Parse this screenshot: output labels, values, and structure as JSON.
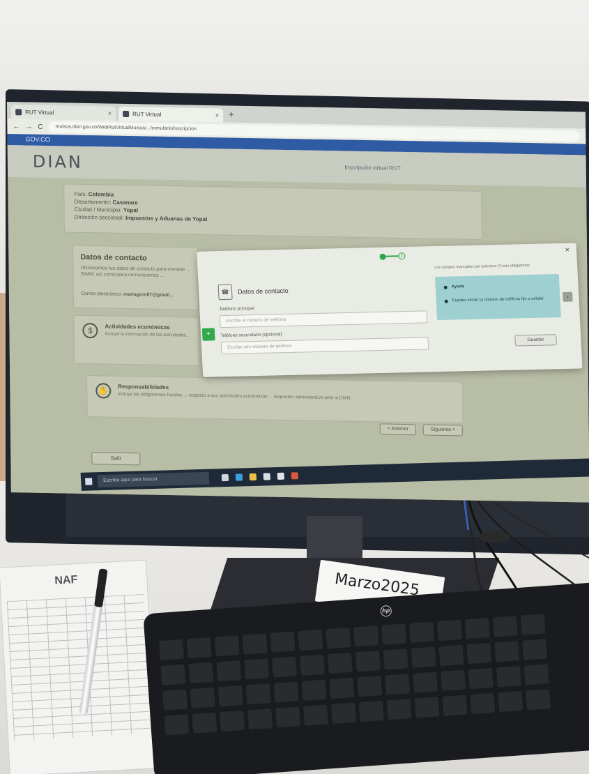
{
  "browser": {
    "tabs": [
      "RUT Virtual",
      "RUT Virtual"
    ],
    "url": "muisca.dian.gov.co/WebRutVirtualMuisca/...formulario/inscripcion"
  },
  "site": {
    "gov_bar": "GOV.CO",
    "logo": "DIAN",
    "header_title": "Inscripción virtual RUT"
  },
  "location": {
    "lines": [
      {
        "label": "País:",
        "value": "Colombia"
      },
      {
        "label": "Departamento:",
        "value": "Casanare"
      },
      {
        "label": "Ciudad / Municipio:",
        "value": "Yopal"
      },
      {
        "label": "Dirección seccional:",
        "value": "Impuestos y Aduanas de Yopal"
      }
    ]
  },
  "contact_card": {
    "title": "Datos de contacto",
    "description": "Utilizaremos tus datos de contacto para enviarte ... SIMM, así como para comunicarnos ...",
    "email_label": "Correo electrónico:",
    "email_value": "mariagom87@gmail..."
  },
  "activities_card": {
    "title": "Actividades económicas",
    "subtitle": "Incluye la información de las actividades..."
  },
  "responsibilities_card": {
    "title": "Responsabilidades",
    "subtitle": "Incluye las obligaciones fiscales ... respecto a sus actividades económicas ... responder administrativo ante la DIAN."
  },
  "navigation": {
    "prev": "< Anterior",
    "next": "Siguiente >",
    "exit": "Salir"
  },
  "modal": {
    "step_current": "1",
    "step_next": "2",
    "section_title": "Datos de contacto",
    "field1_label": "Teléfono principal",
    "field1_placeholder": "Escribe el número de teléfono",
    "field2_label": "Teléfono secundario (opcional)",
    "field2_placeholder": "Escribe otro número de teléfono",
    "help_text": "Los campos marcados con asterisco (*) son obligatorios",
    "help_title": "Ayuda",
    "help_item": "Puedes incluir tu número de teléfono fijo o celular.",
    "save_button": "Guardar"
  },
  "taskbar": {
    "search_placeholder": "Escribe aquí para buscar"
  },
  "desk": {
    "form_logo": "NAF",
    "sticky_label": "Marzo2025",
    "monitor_brand": "hp"
  },
  "colors": {
    "accent_green": "#2fa64a",
    "gov_blue": "#2f5aa4",
    "help_teal": "#9ed0d1"
  }
}
